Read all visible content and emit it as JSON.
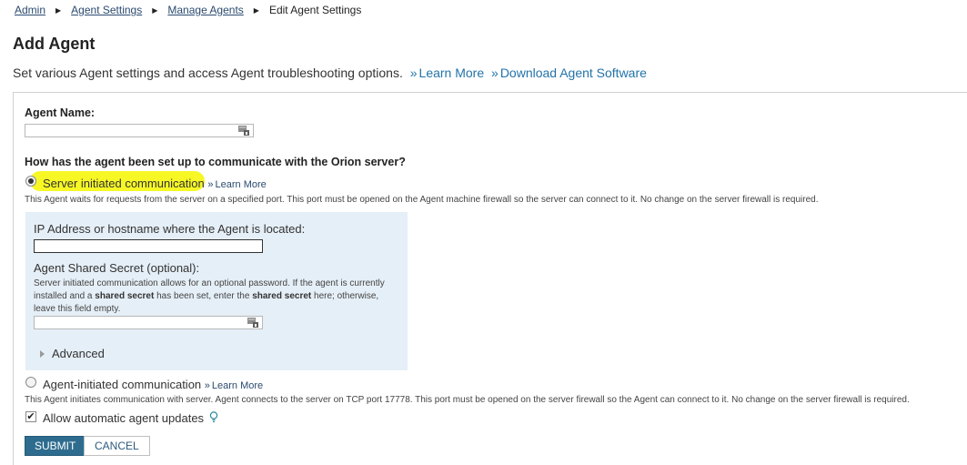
{
  "breadcrumb": {
    "items": [
      {
        "label": "Admin"
      },
      {
        "label": "Agent Settings"
      },
      {
        "label": "Manage Agents"
      }
    ],
    "current": "Edit Agent Settings"
  },
  "page": {
    "title": "Add Agent",
    "subtitle": "Set various Agent settings and access Agent troubleshooting options.",
    "learn_more": "Learn More",
    "download": "Download Agent Software"
  },
  "form": {
    "agent_name_label": "Agent Name:",
    "agent_name_value": "",
    "question": "How has the agent been set up to communicate with the Orion server?",
    "server_option": {
      "label": "Server initiated communication",
      "learn_more": "Learn More",
      "selected": true,
      "description": "This Agent waits for requests from the server on a specified port. This port must be opened on the Agent machine firewall so the server can connect to it. No change on the server firewall is required."
    },
    "ip_label": "IP Address or hostname where the Agent is located:",
    "ip_value": "",
    "secret_label": "Agent Shared Secret (optional):",
    "secret_help_1": "Server initiated communication allows for an optional password. If the agent is currently installed and a",
    "secret_help_bold1": "shared secret",
    "secret_help_2": "has been set, enter the",
    "secret_help_bold2": "shared secret",
    "secret_help_3": "here; otherwise, leave this field empty.",
    "secret_value": "",
    "advanced_label": "Advanced",
    "agent_option": {
      "label": "Agent-initiated communication",
      "learn_more": "Learn More",
      "selected": false,
      "description": "This Agent initiates communication with server. Agent connects to the server on TCP port 17778. This port must be opened on the server firewall so the Agent can connect to it. No change on the server firewall is required."
    },
    "auto_update_label": "Allow automatic agent updates",
    "auto_update_checked": true,
    "submit_label": "SUBMIT",
    "cancel_label": "CANCEL"
  },
  "icons": {
    "key": "key-icon",
    "chevron": "chevron-right-icon",
    "hint": "lightbulb-icon",
    "checkmark": "✔"
  },
  "colors": {
    "link": "#2273a9",
    "highlight": "#f7f726",
    "panel_bg": "#e5eff7",
    "submit_bg": "#2e6c8f"
  }
}
